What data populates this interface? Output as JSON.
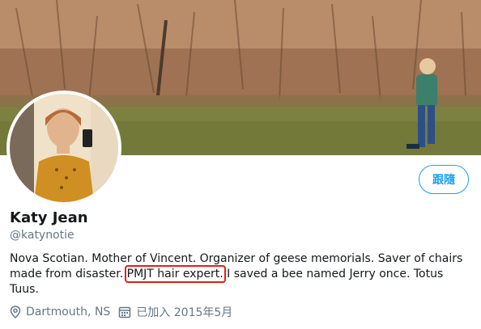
{
  "profile": {
    "name": "Katy Jean",
    "handle": "@katynotie",
    "bio_part1": "Nova Scotian. Mother of Vincent. Organizer of geese memorials. Saver of chairs made from disaster. ",
    "bio_highlight": "PMJT hair expert.",
    "bio_part2": " I saved a bee named Jerry once. Totus Tuus.",
    "location": "Dartmouth, NS",
    "joined": "已加入 2015年5月"
  },
  "actions": {
    "follow_label": "跟隨"
  },
  "colors": {
    "accent": "#1da1f2",
    "highlight_box": "#e0201b",
    "secondary_text": "#657786"
  },
  "icons": {
    "location": "location-pin-icon",
    "calendar": "calendar-icon"
  }
}
